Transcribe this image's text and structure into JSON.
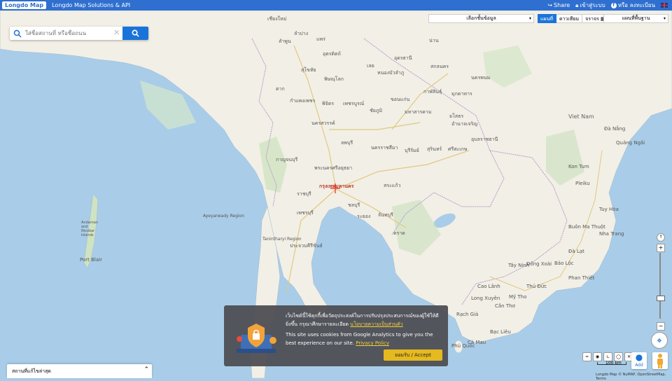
{
  "topbar": {
    "logo": "Longdo Map",
    "brand": "Longdo Map Solutions & API",
    "share": "Share",
    "login": "เข้าสู่ระบบ",
    "or_register": "หรือ ลงทะเบียน"
  },
  "search": {
    "placeholder": "ใส่ชื่อสถานที่ หรือชื่อถนน",
    "clear": "✕"
  },
  "layers": {
    "select_label": "เลือกชั้นข้อมูล",
    "map_types": [
      "แผนที่",
      "ดาวเทียม",
      "จราจร"
    ],
    "active_map_type": "แผนที่",
    "basemap_label": "แผนที่พื้นฐาน"
  },
  "map_labels": {
    "cities": [
      {
        "name": "เชียงใหม่"
      },
      {
        "name": "ลำปาง"
      },
      {
        "name": "ลำพูน"
      },
      {
        "name": "แพร่"
      },
      {
        "name": "น่าน"
      },
      {
        "name": "อุตรดิตถ์"
      },
      {
        "name": "สุโขทัย"
      },
      {
        "name": "พิษณุโลก"
      },
      {
        "name": "เลย"
      },
      {
        "name": "หนองบัวลำภู"
      },
      {
        "name": "อุดรธานี"
      },
      {
        "name": "สกลนคร"
      },
      {
        "name": "กาฬสินธุ์"
      },
      {
        "name": "มหาสารคาม"
      },
      {
        "name": "ขอนแก่น"
      },
      {
        "name": "ชัยภูมิ"
      },
      {
        "name": "นครราชสีมา"
      },
      {
        "name": "บุรีรัมย์"
      },
      {
        "name": "สุรินทร์"
      },
      {
        "name": "ศรีสะเกษ"
      },
      {
        "name": "อุบลราชธานี"
      },
      {
        "name": "ยโสธร"
      },
      {
        "name": "นครสวรรค์"
      },
      {
        "name": "กำแพงเพชร"
      },
      {
        "name": "พิจิตร"
      },
      {
        "name": "เพชรบูรณ์"
      },
      {
        "name": "ลพบุรี"
      },
      {
        "name": "กาญจนบุรี"
      },
      {
        "name": "พระนครศรีอยุธยา"
      },
      {
        "name": "กรุงเทพมหานคร"
      },
      {
        "name": "ราชบุรี"
      },
      {
        "name": "เพชรบุรี"
      },
      {
        "name": "ชลบุรี"
      },
      {
        "name": "ระยอง"
      },
      {
        "name": "จันทบุรี"
      },
      {
        "name": "ตราด"
      },
      {
        "name": "สระแก้ว"
      },
      {
        "name": "ประจวบคีรีขันธ์"
      },
      {
        "name": "ตาก"
      },
      {
        "name": "นครพนม"
      },
      {
        "name": "มุกดาหาร"
      },
      {
        "name": "อำนาจเจริญ"
      },
      {
        "name": "Viet Nam"
      },
      {
        "name": "Đà Nẵng"
      },
      {
        "name": "Quảng Ngãi"
      },
      {
        "name": "Kon Tum"
      },
      {
        "name": "Pleiku"
      },
      {
        "name": "Tuy Hòa"
      },
      {
        "name": "Buôn Ma Thuột"
      },
      {
        "name": "Nha Trang"
      },
      {
        "name": "Đà Lạt"
      },
      {
        "name": "Phan Thiết"
      },
      {
        "name": "Thủ Đức"
      },
      {
        "name": "Cần Thơ"
      },
      {
        "name": "Long Xuyên"
      },
      {
        "name": "Rạch Giá"
      },
      {
        "name": "Bạc Liêu"
      },
      {
        "name": "Cà Mau"
      },
      {
        "name": "Phú Quốc"
      },
      {
        "name": "Port Blair"
      },
      {
        "name": "Andaman and Nicobar Islands"
      },
      {
        "name": "Đồng Xoài"
      },
      {
        "name": "Bảo Lộc"
      },
      {
        "name": "Cao Lãnh"
      },
      {
        "name": "Mỹ Tho"
      },
      {
        "name": "Tây Ninh"
      },
      {
        "name": "Ayeyarwady Region"
      },
      {
        "name": "Tanintharyi Region"
      }
    ]
  },
  "cookie": {
    "th_text": "เว็บไซต์นี้ใช้คุกกี้เพื่อวัตถุประสงค์ในการปรับปรุงประสบการณ์ของผู้ใช้ให้ดียิ่งขึ้น กรุณาศึกษารายละเอียด",
    "th_link": "นโยบายความเป็นส่วนตัว",
    "en_text": "This site uses cookies from Google Analytics to give you the best experience on our site.",
    "en_link": "Privacy Policy",
    "accept": "ยอมรับ / Accept"
  },
  "bottom_panel": {
    "label": "สถานที่แก้ไขล่าสุด"
  },
  "map_controls": {
    "scale_label": "100 km",
    "add_label": "Add",
    "attribution": "Longdo Map © NuMAP, OpenStreetMap, Terms",
    "zoom_level": "7"
  },
  "colors": {
    "topbar": "#2f6fcf",
    "search_button": "#1a73d9",
    "accept": "#e5b920",
    "water": "#a9cde8",
    "land": "#f2efe6"
  }
}
